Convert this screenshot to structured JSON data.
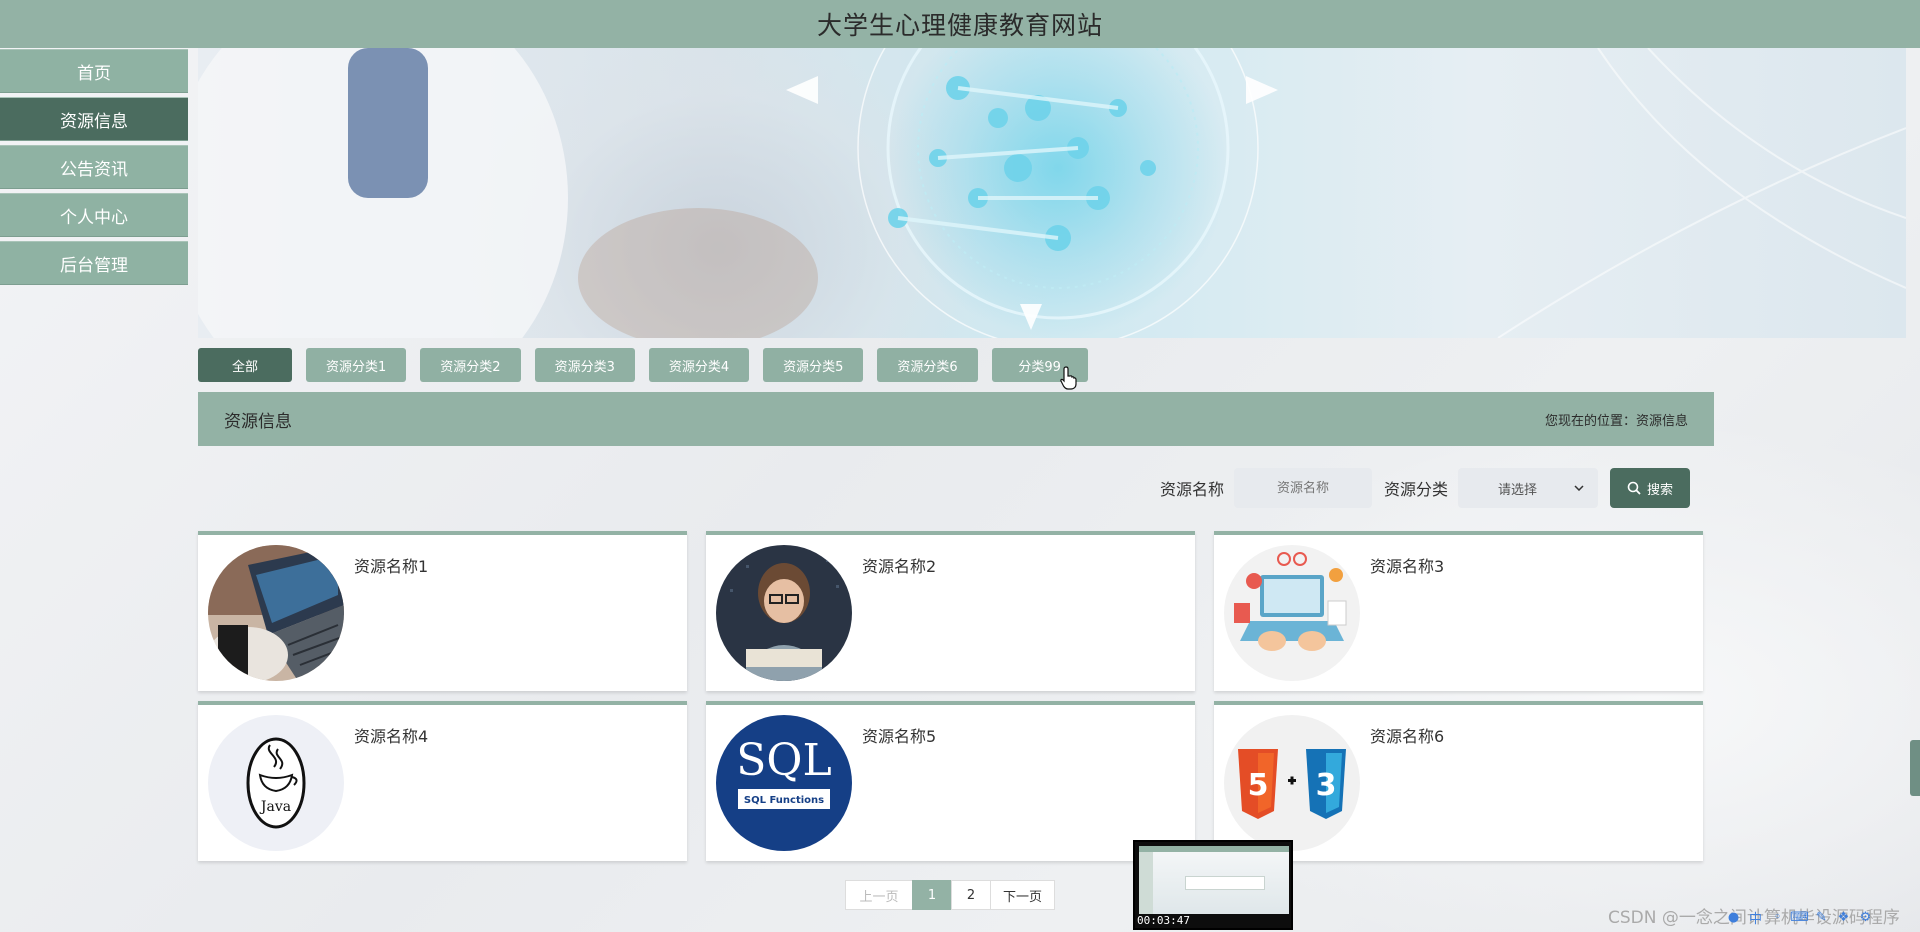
{
  "header": {
    "title": "大学生心理健康教育网站"
  },
  "sidebar": {
    "items": [
      {
        "label": "首页",
        "active": false
      },
      {
        "label": "资源信息",
        "active": true
      },
      {
        "label": "公告资讯",
        "active": false
      },
      {
        "label": "个人中心",
        "active": false
      },
      {
        "label": "后台管理",
        "active": false
      }
    ]
  },
  "tabs": [
    {
      "label": "全部",
      "active": true
    },
    {
      "label": "资源分类1",
      "active": false
    },
    {
      "label": "资源分类2",
      "active": false
    },
    {
      "label": "资源分类3",
      "active": false
    },
    {
      "label": "资源分类4",
      "active": false
    },
    {
      "label": "资源分类5",
      "active": false
    },
    {
      "label": "资源分类6",
      "active": false
    },
    {
      "label": "分类99",
      "active": false
    }
  ],
  "section": {
    "title": "资源信息",
    "breadcrumb_prefix": "您现在的位置：",
    "breadcrumb_current": "资源信息"
  },
  "search": {
    "name_label": "资源名称",
    "name_placeholder": "资源名称",
    "category_label": "资源分类",
    "category_value": "请选择",
    "button_label": "搜索"
  },
  "cards": [
    {
      "name": "资源名称1",
      "icon": "laptop-photo-icon"
    },
    {
      "name": "资源名称2",
      "icon": "child-keyboard-photo-icon"
    },
    {
      "name": "资源名称3",
      "icon": "laptop-illustration-icon"
    },
    {
      "name": "资源名称4",
      "icon": "java-logo-icon"
    },
    {
      "name": "资源名称5",
      "icon": "sql-logo-icon"
    },
    {
      "name": "资源名称6",
      "icon": "html5-css3-logo-icon"
    }
  ],
  "thumb_texts": {
    "sql_title": "SQL",
    "sql_sub": "SQL Functions",
    "java": "Java",
    "html_num": "5",
    "css_num": "3"
  },
  "pagination": {
    "prev": "上一页",
    "pages": [
      "1",
      "2"
    ],
    "current": "1",
    "next": "下一页"
  },
  "video": {
    "time": "00:03:47"
  },
  "watermark": "CSDN @一念之间计算机毕设源码程序",
  "colors": {
    "header": "#93b2a5",
    "nav": "#8fb2a3",
    "nav_active": "#4b6c5f",
    "button_dark": "#4b6c5f"
  }
}
